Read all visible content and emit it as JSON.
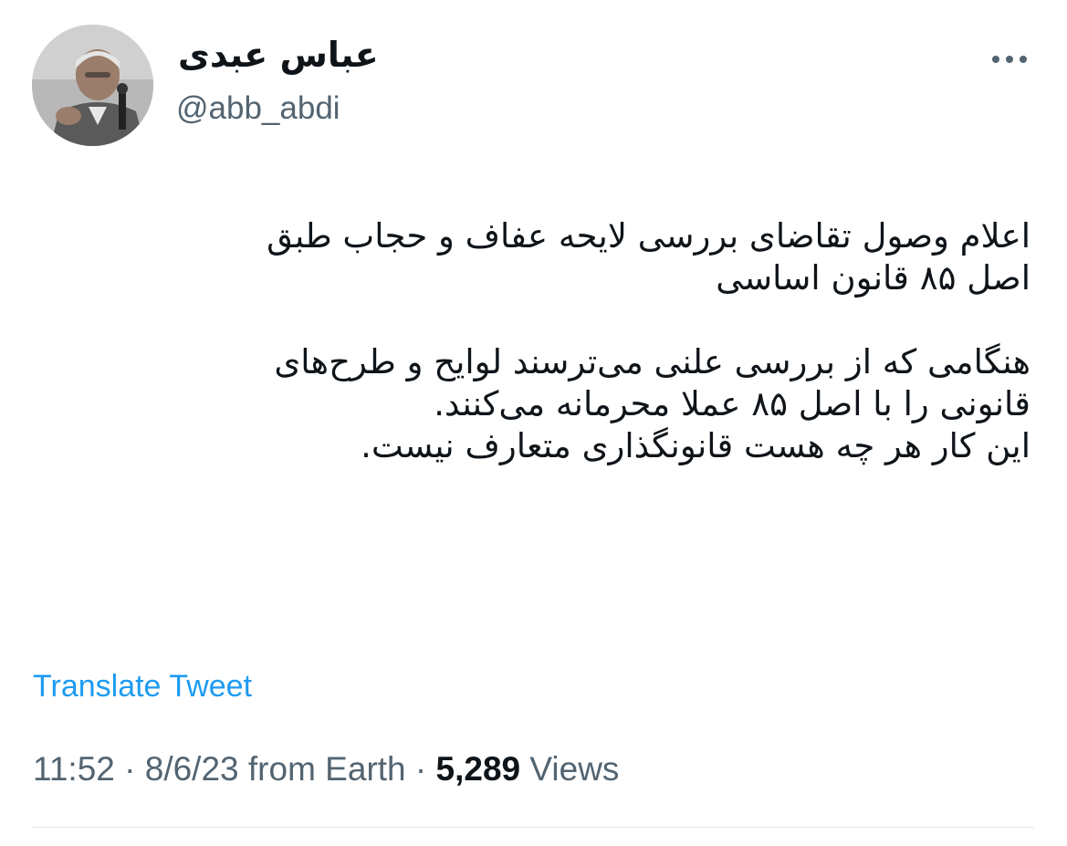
{
  "author": {
    "name": "عباس عبدی",
    "handle": "@abb_abdi"
  },
  "tweet": {
    "text": "اعلام وصول تقاضای بررسی لایحه عفاف و حجاب طبق\nاصل ۸۵ قانون اساسی\n\nهنگامی که از بررسی علنی می‌ترسند لوایح و طرح‌های\nقانونی را با اصل ۸۵ عملا محرمانه می‌کنند.\nاین کار هر چه هست قانونگذاری متعارف نیست.",
    "translate_label": "Translate Tweet"
  },
  "meta": {
    "time": "11:52",
    "sep1": " · ",
    "date": "8/6/23",
    "source": " from Earth",
    "sep2": " · ",
    "views_count": "5,289",
    "views_label": " Views"
  },
  "icons": {
    "more": "more-horizontal-icon"
  },
  "colors": {
    "link": "#1d9bf0",
    "secondary_text": "#536471",
    "primary_text": "#0f1419",
    "divider": "#e1e5e8"
  }
}
